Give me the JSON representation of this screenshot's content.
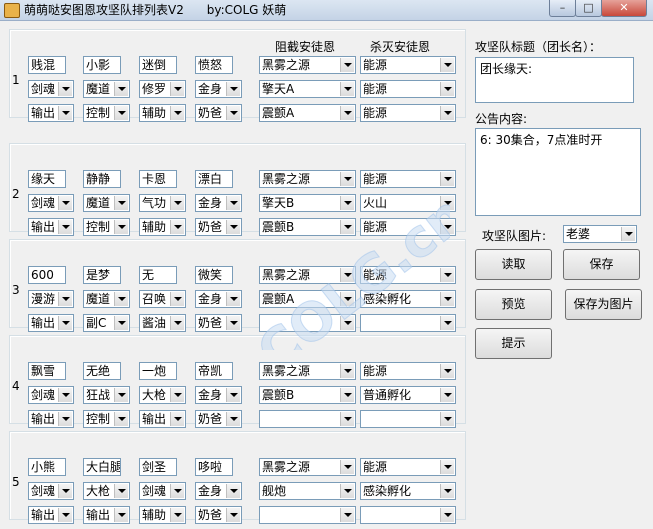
{
  "window": {
    "title": "萌萌哒安图恩攻坚队排列表V2      by:COLG 妖萌"
  },
  "headers": {
    "block": "阻截安徒恩",
    "kill": "杀灭安徒恩"
  },
  "groups": [
    {
      "num": "1",
      "names": [
        "贱混",
        "小影",
        "迷倒",
        "愤怒"
      ],
      "classes": [
        "剑魂",
        "魔道",
        "修罗",
        "金身"
      ],
      "roles": [
        "输出",
        "控制",
        "辅助",
        "奶爸"
      ],
      "block": [
        "黑雾之源",
        "擎天A",
        "震颤A"
      ],
      "kill": [
        "能源",
        "能源",
        "能源"
      ]
    },
    {
      "num": "2",
      "names": [
        "缘天",
        "静静",
        "卡恩",
        "漂白"
      ],
      "classes": [
        "剑魂",
        "魔道",
        "气功",
        "金身"
      ],
      "roles": [
        "输出",
        "控制",
        "辅助",
        "奶爸"
      ],
      "block": [
        "黑雾之源",
        "擎天B",
        "震颤B"
      ],
      "kill": [
        "能源",
        "火山",
        "能源"
      ]
    },
    {
      "num": "3",
      "names": [
        "600",
        "是梦",
        "无",
        "微笑"
      ],
      "classes": [
        "漫游",
        "魔道",
        "召唤",
        "金身"
      ],
      "roles": [
        "输出",
        "副C",
        "酱油",
        "奶爸"
      ],
      "block": [
        "黑雾之源",
        "震颤A",
        ""
      ],
      "kill": [
        "能源",
        "感染孵化",
        ""
      ]
    },
    {
      "num": "4",
      "names": [
        "飘雪",
        "无绝",
        "一炮",
        "帝凯"
      ],
      "classes": [
        "剑魂",
        "狂战",
        "大枪",
        "金身"
      ],
      "roles": [
        "输出",
        "控制",
        "输出",
        "奶爸"
      ],
      "block": [
        "黑雾之源",
        "震颤B",
        ""
      ],
      "kill": [
        "能源",
        "普通孵化",
        ""
      ]
    },
    {
      "num": "5",
      "names": [
        "小熊",
        "大白腿",
        "剑圣",
        "哆啦"
      ],
      "classes": [
        "剑魂",
        "大枪",
        "剑魂",
        "金身"
      ],
      "roles": [
        "输出",
        "输出",
        "辅助",
        "奶爸"
      ],
      "block": [
        "黑雾之源",
        "舰炮",
        ""
      ],
      "kill": [
        "能源",
        "感染孵化",
        ""
      ]
    }
  ],
  "side": {
    "title_label": "攻坚队标题（团长名）：",
    "title_value": "团长缘天:",
    "notice_label": "公告内容:",
    "notice_value": "6: 30集合，7点准时开",
    "image_label": "攻坚队图片:",
    "image_value": "老婆",
    "buttons": {
      "read": "读取",
      "save": "保存",
      "preview": "预览",
      "save_image": "保存为图片",
      "hint": "提示"
    }
  },
  "watermark": "COLG.cn"
}
